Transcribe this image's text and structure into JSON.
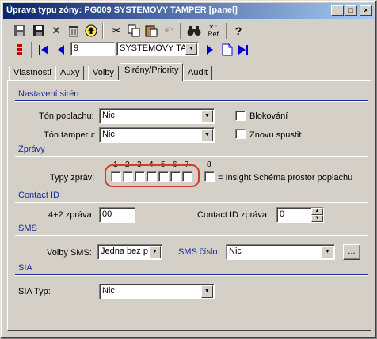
{
  "window": {
    "title": "Úprava typu zóny: PG009 SYSTEMOVY TAMPER [panel]",
    "controls": {
      "minimize": "_",
      "maximize": "□",
      "close": "×"
    }
  },
  "toolbar": {
    "row1_icons": [
      "save-icon",
      "save-as-icon",
      "delete-icon",
      "trash-icon",
      "up-icon",
      "cut-icon",
      "copy-icon",
      "paste-icon",
      "undo-icon",
      "binoculars-icon",
      "references-icon",
      "help-icon"
    ],
    "ref_label": "Ref",
    "help_label": "?",
    "record_number": "9",
    "record_name": "SYSTEMOVY TA"
  },
  "tabs": [
    {
      "label": "Vlastnosti"
    },
    {
      "label": "Auxy"
    },
    {
      "label": "Volby"
    },
    {
      "label": "Sirény/Priority"
    },
    {
      "label": "Audit"
    }
  ],
  "sections": {
    "sirens": {
      "title": "Nastavení sirén",
      "alarm_tone_label": "Tón poplachu:",
      "alarm_tone_value": "Nic",
      "tamper_tone_label": "Tón tamperu:",
      "tamper_tone_value": "Nic",
      "blocking_label": "Blokování",
      "restart_label": "Znovu spustit"
    },
    "messages": {
      "title": "Zprávy",
      "types_label": "Typy zpráv:",
      "numbers": [
        "1",
        "2",
        "3",
        "4",
        "5",
        "6",
        "7"
      ],
      "number8": "8",
      "insight_label": "= Insight Schéma prostor poplachu"
    },
    "contact_id": {
      "title": "Contact ID",
      "msg42_label": "4+2 zpráva:",
      "msg42_value": "00",
      "cid_label": "Contact ID zpráva:",
      "cid_value": "0"
    },
    "sms": {
      "title": "SMS",
      "options_label": "Volby SMS:",
      "options_value": "Jedna bez p",
      "number_label": "SMS číslo:",
      "number_value": "Nic",
      "browse_label": "..."
    },
    "sia": {
      "title": "SIA",
      "type_label": "SIA Typ:",
      "type_value": "Nic"
    }
  },
  "colors": {
    "highlight_ring": "#d43a2a",
    "section_text": "#1a2a9a",
    "nav_blue": "#0000cc"
  }
}
